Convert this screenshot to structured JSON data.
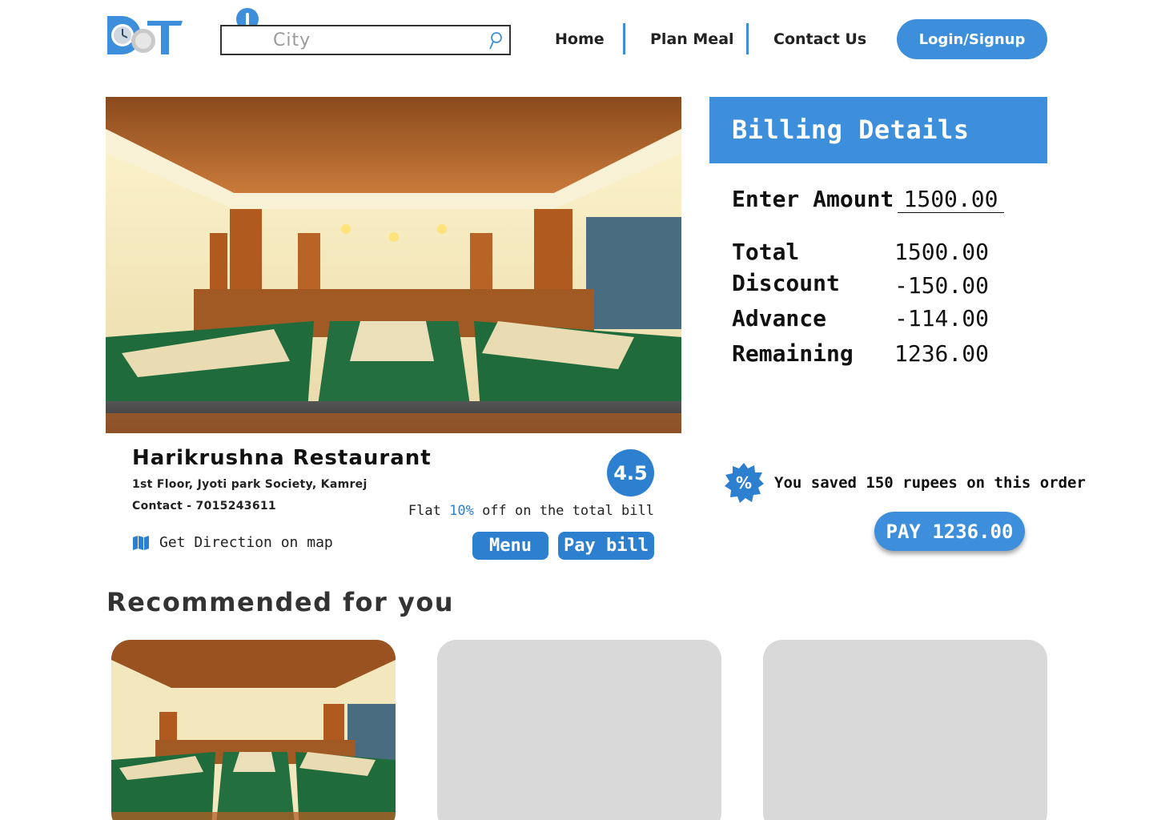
{
  "header": {
    "logo_text": "DOT",
    "search": {
      "placeholder": "City",
      "value": ""
    },
    "nav": [
      "Home",
      "Plan Meal",
      "Contact Us"
    ],
    "login_label": "Login/Signup"
  },
  "restaurant": {
    "name": "Harikrushna Restaurant",
    "address": "1st Floor, Jyoti park Society, Kamrej",
    "contact": "Contact - 7015243611",
    "map_link": "Get Direction on map",
    "rating": "4.5",
    "offer": {
      "prefix": "Flat ",
      "percent": "10%",
      "suffix": " off on the total bill"
    },
    "menu_label": "Menu",
    "pay_bill_label": "Pay bill"
  },
  "billing": {
    "title": "Billing Details",
    "enter_amount_label": "Enter Amount",
    "enter_amount_value": "1500.00",
    "rows": [
      {
        "label": "Total",
        "value": "1500.00"
      },
      {
        "label": "Discount",
        "value": "-150.00"
      },
      {
        "label": "Advance",
        "value": "-114.00"
      },
      {
        "label": "Remaining",
        "value": "1236.00"
      }
    ],
    "saved_text": "You saved 150 rupees on this order",
    "pay_label": "PAY 1236.00"
  },
  "recommended": {
    "title": "Recommended for you"
  },
  "colors": {
    "accent": "#3e8fdb",
    "accent_dark": "#2d7fd0",
    "placeholder_card": "#d9d9d9"
  },
  "icons": [
    "logo-icon",
    "location-pin-icon",
    "search-icon",
    "map-icon",
    "percent-badge-icon"
  ]
}
